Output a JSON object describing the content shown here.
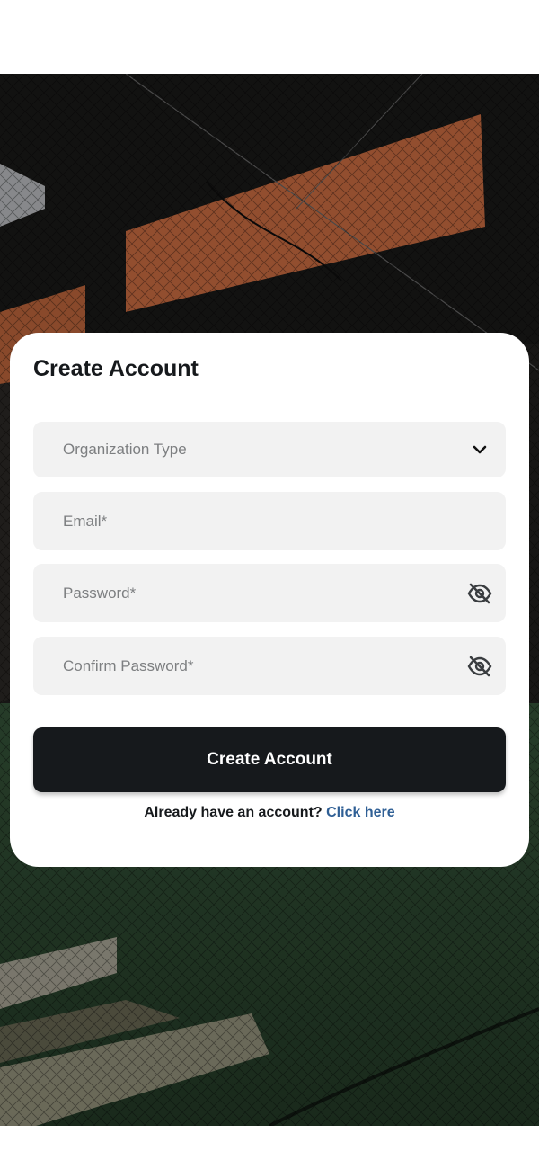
{
  "card": {
    "title": "Create Account"
  },
  "form": {
    "organization_type": {
      "placeholder": "Organization Type",
      "icon": "chevron-down-icon"
    },
    "email": {
      "placeholder": "Email*"
    },
    "password": {
      "placeholder": "Password*",
      "icon": "eye-off-icon"
    },
    "confirm_password": {
      "placeholder": "Confirm Password*",
      "icon": "eye-off-icon"
    },
    "submit_label": "Create Account"
  },
  "signin": {
    "prompt": "Already have an account?",
    "link_label": "Click here"
  },
  "colors": {
    "primary_button": "#16191c",
    "link": "#2f5f95",
    "field_background": "#f2f2f2",
    "placeholder": "#7d7f81"
  }
}
